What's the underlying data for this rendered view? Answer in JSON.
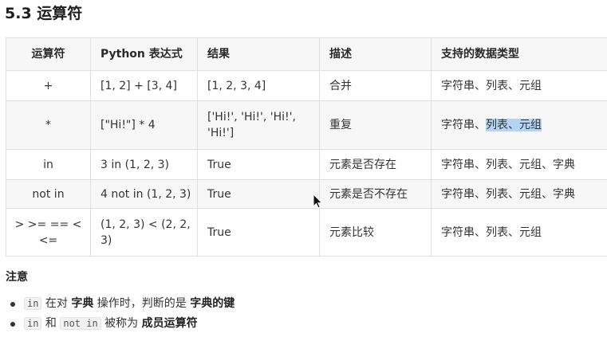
{
  "title": "5.3 运算符",
  "table": {
    "headers": [
      "运算符",
      "Python 表达式",
      "结果",
      "描述",
      "支持的数据类型"
    ],
    "rows": [
      {
        "op": "+",
        "expr": "[1, 2] + [3, 4]",
        "result": "[1, 2, 3, 4]",
        "desc": "合并",
        "types": "字符串、列表、元组"
      },
      {
        "op": "*",
        "expr": "[\"Hi!\"] * 4",
        "result": "['Hi!', 'Hi!', 'Hi!', 'Hi!']",
        "desc": "重复",
        "types_plain": "字符串、",
        "types_selected": "列表、元组"
      },
      {
        "op": "in",
        "expr": "3 in (1, 2, 3)",
        "result": "True",
        "desc": "元素是否存在",
        "types": "字符串、列表、元组、字典"
      },
      {
        "op": "not in",
        "expr": "4 not in (1, 2, 3)",
        "result": "True",
        "desc": "元素是否不存在",
        "types": "字符串、列表、元组、字典"
      },
      {
        "op": "> >= == < <=",
        "expr": "(1, 2, 3) < (2, 2, 3)",
        "result": "True",
        "desc": "元素比较",
        "types": "字符串、列表、元组"
      }
    ]
  },
  "note": {
    "heading": "注意",
    "item1": {
      "code": "in",
      "t1": " 在对 ",
      "b1": "字典",
      "t2": " 操作时，判断的是 ",
      "b2": "字典的键"
    },
    "item2": {
      "code1": "in",
      "t1": " 和 ",
      "code2": "not in",
      "t2": " 被称为 ",
      "b1": "成员运算符"
    }
  },
  "colors": {
    "selection": "#b5d4f5",
    "header_bg": "#f7f7f7",
    "border": "#dfdfdf"
  },
  "icons": {
    "cursor": "mouse-pointer-icon"
  }
}
